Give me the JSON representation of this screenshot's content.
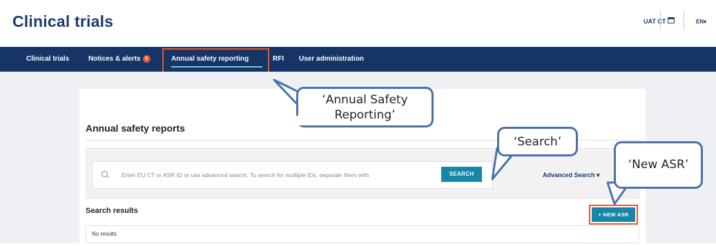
{
  "header": {
    "app_title": "Clinical trials",
    "user_label": "UAT CT",
    "calendar_icon": "calendar-icon",
    "language": "EN",
    "language_chevron": "▾"
  },
  "nav": {
    "items": [
      {
        "label": "Clinical trials"
      },
      {
        "label": "Notices & alerts",
        "badge": "0"
      },
      {
        "label": "Annual safety reporting",
        "active": true
      },
      {
        "label": "RFI"
      },
      {
        "label": "User administration"
      }
    ],
    "background": "#153567",
    "active_underline_color": "#7fc7d6"
  },
  "main": {
    "section_title": "Annual safety reports",
    "search": {
      "placeholder": "Enter EU CT or ASR ID or use advanced search. To search for multiple IDs, separate them with",
      "button_label": "SEARCH",
      "advanced_label": "Advanced Search ▾"
    },
    "results": {
      "title": "Search results",
      "new_button_label": "+ NEW ASR",
      "empty_text": "No results"
    },
    "accent_color": "#1687a7"
  },
  "annotations": {
    "highlight_color": "#e8542b",
    "callout_border_color": "#4a72a8",
    "callouts": [
      {
        "line1": "‘Annual Safety",
        "line2": "Reporting’"
      },
      {
        "line1": "‘Search’"
      },
      {
        "line1": "‘New ASR’"
      }
    ]
  }
}
